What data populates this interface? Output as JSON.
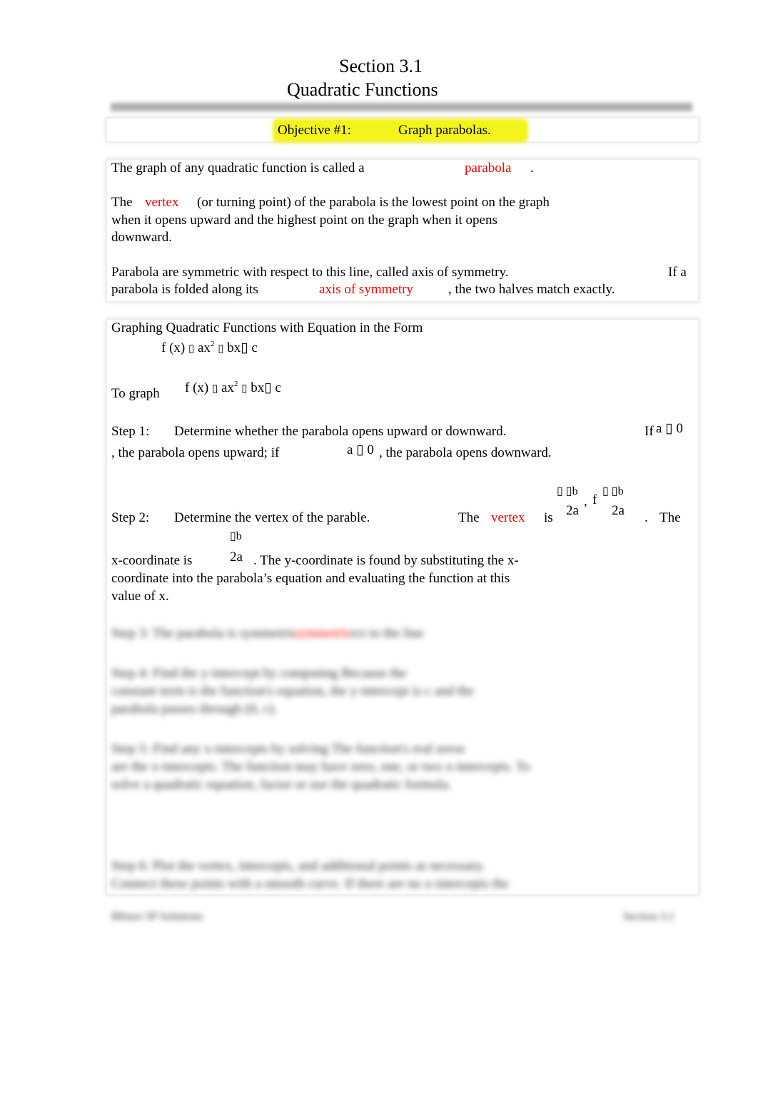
{
  "header": {
    "section": "Section 3.1",
    "title": "Quadratic Functions"
  },
  "objective": {
    "label": "Objective #1:",
    "text": "Graph parabolas."
  },
  "intro": {
    "p1_a": "The graph of any quadratic function is called a",
    "p1_term": "parabola",
    "p1_end": ".",
    "p2_a": "The",
    "p2_term": "vertex",
    "p2_b": "(or turning point) of the parabola is the lowest point on the graph",
    "p2_c": "when it opens upward and the highest point on the graph when it opens",
    "p2_d": "downward.",
    "p3_a": "Parabola are symmetric with respect to this line, called axis of symmetry.",
    "p3_b": "If a",
    "p3_c": "parabola is folded along its",
    "p3_term": "axis of symmetry",
    "p3_d": ", the two halves match exactly."
  },
  "graphing": {
    "heading": "Graphing Quadratic Functions with Equation in the Form",
    "form": {
      "fx": "f (x)",
      "eq": "▯",
      "ax": "ax",
      "exp": "2",
      "plus": "▯",
      "bx": "bx▯",
      "c": "c"
    },
    "to_graph": "To graph",
    "step1": {
      "label": "Step 1:",
      "text": "Determine whether the parabola opens upward or downward.",
      "if": "If",
      "cond1": "a ▯  0",
      "line2_a": ", the parabola opens upward; if",
      "cond2": "a ▯  0",
      "line2_b": ", the parabola opens downward."
    },
    "step2": {
      "label": "Step 2:",
      "text": "Determine the vertex of the parable.",
      "the": "The",
      "term": "vertex",
      "is": "is",
      "num": "▯ ▯b",
      "den": "2a",
      "f": "f",
      "end": ".",
      "the2": "The",
      "xcoord": "x-coordinate is",
      "xnum": "▯b",
      "xden": "2a",
      "line_b": ".   The y-coordinate is found by substituting the x-",
      "line_c": "coordinate into the parabola’s equation and evaluating the function at this",
      "line_d": "value of x."
    },
    "blurred": [
      "Step 3:   The parabola is symmetric with respect to the line",
      "Step 4:   Find the y-intercept by computing         Because          the",
      "constant term is the function's equation, the y-intercept is c and the",
      "parabola passes through (0, c).",
      "Step 5:   Find any x-intercepts by solving           The function's real zeros",
      "are the x-intercepts.   The function may have zero, one, or two x-intercepts.   To",
      "solve a quadratic equation, factor or use the quadratic formula.",
      "Step 6:   Plot the vertex, intercepts, and additional points as necessary.",
      "Connect these points with a smooth curve.  If there are no x-intercepts the"
    ],
    "blurred_term": "symmetric"
  },
  "footer": {
    "left": "Blitzer 5P Solutions",
    "right": "Section 3.1"
  }
}
